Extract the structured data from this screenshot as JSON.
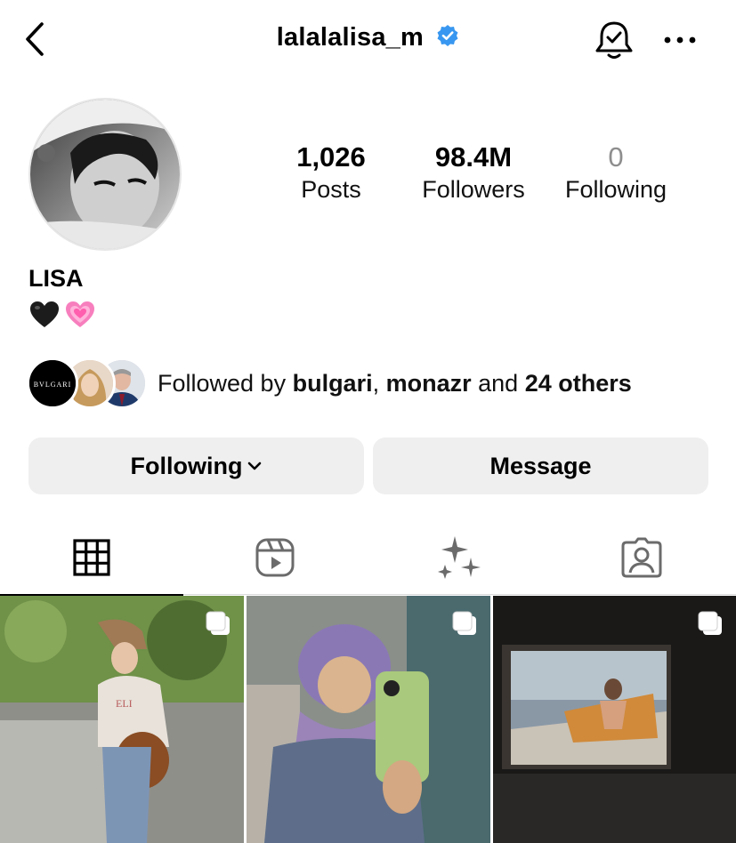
{
  "header": {
    "username": "lalalalisa_m",
    "verified": true,
    "icons": {
      "back": "chevron-left-icon",
      "verified": "verified-badge-icon",
      "bell": "bell-check-icon",
      "more": "more-horizontal-icon"
    },
    "verified_color": "#3897f0"
  },
  "profile": {
    "stats": [
      {
        "value": "1,026",
        "label": "Posts"
      },
      {
        "value": "98.4M",
        "label": "Followers"
      },
      {
        "value": "0",
        "label": "Following"
      }
    ],
    "full_name": "LISA",
    "bio_emojis": [
      "black-heart",
      "growing-pink-heart"
    ]
  },
  "followed_by": {
    "prefix": "Followed by ",
    "user1": "bulgari",
    "sep": ", ",
    "user2": "monazr",
    "and": " and ",
    "others": "24 others",
    "bulgari_logo_text": "BVLGARI"
  },
  "actions": {
    "following_label": "Following",
    "message_label": "Message"
  },
  "tabs": [
    {
      "name": "grid",
      "icon": "grid-icon",
      "active": true
    },
    {
      "name": "reels",
      "icon": "reels-icon",
      "active": false
    },
    {
      "name": "ai",
      "icon": "sparkles-icon",
      "active": false
    },
    {
      "name": "tagged",
      "icon": "tagged-person-icon",
      "active": false
    }
  ],
  "posts": [
    {
      "type": "carousel",
      "description_icon": "multiple-posts-icon"
    },
    {
      "type": "carousel",
      "description_icon": "multiple-posts-icon"
    },
    {
      "type": "carousel",
      "description_icon": "multiple-posts-icon"
    }
  ]
}
